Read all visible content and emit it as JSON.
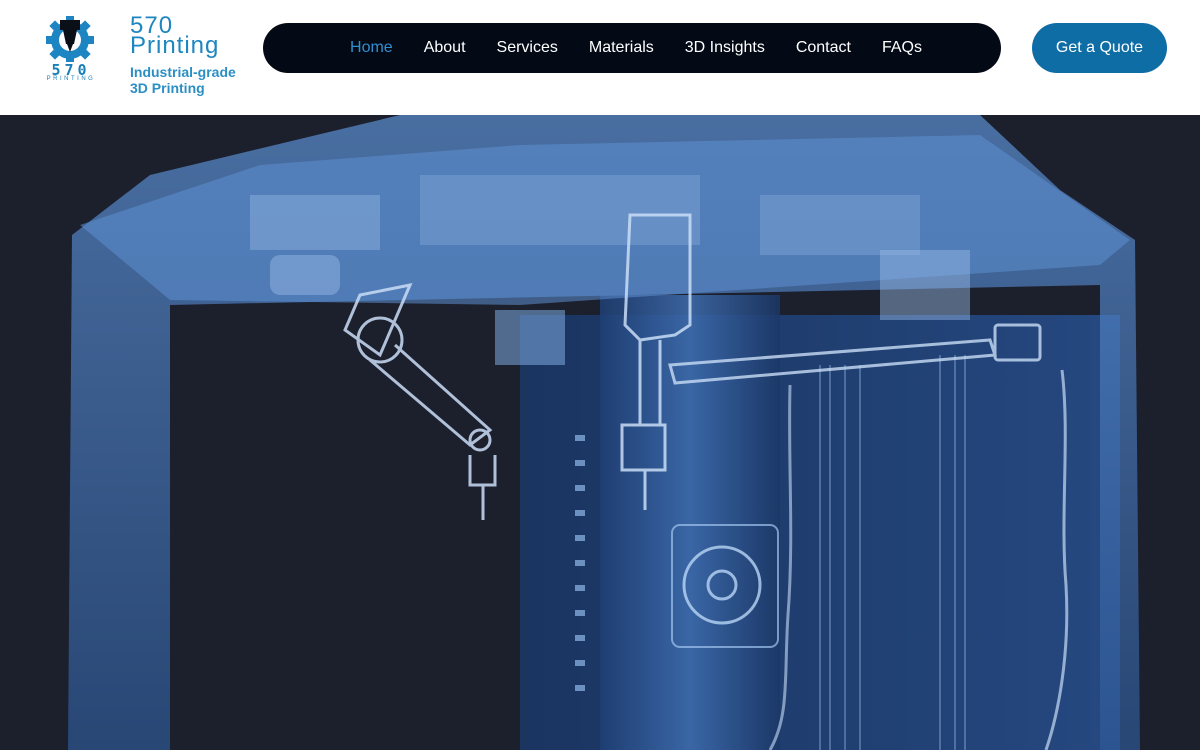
{
  "brand": {
    "logo_number": "570",
    "logo_word": "PRINTING",
    "name_line1": "570",
    "name_line2": "Printing",
    "tagline_line1": "Industrial-grade",
    "tagline_line2": "3D Printing"
  },
  "nav": {
    "items": [
      {
        "label": "Home",
        "active": true
      },
      {
        "label": "About"
      },
      {
        "label": "Services"
      },
      {
        "label": "Materials"
      },
      {
        "label": "3D Insights"
      },
      {
        "label": "Contact"
      },
      {
        "label": "FAQs"
      }
    ]
  },
  "cta": {
    "label": "Get a Quote"
  },
  "hero": {
    "image": "printer-xray-illustration"
  },
  "colors": {
    "brand_blue": "#1e86c0",
    "nav_bg": "#030a16",
    "nav_active": "#2f8fd0",
    "cta_bg": "#0f6da6",
    "hero_bg": "#1c1f2c"
  }
}
